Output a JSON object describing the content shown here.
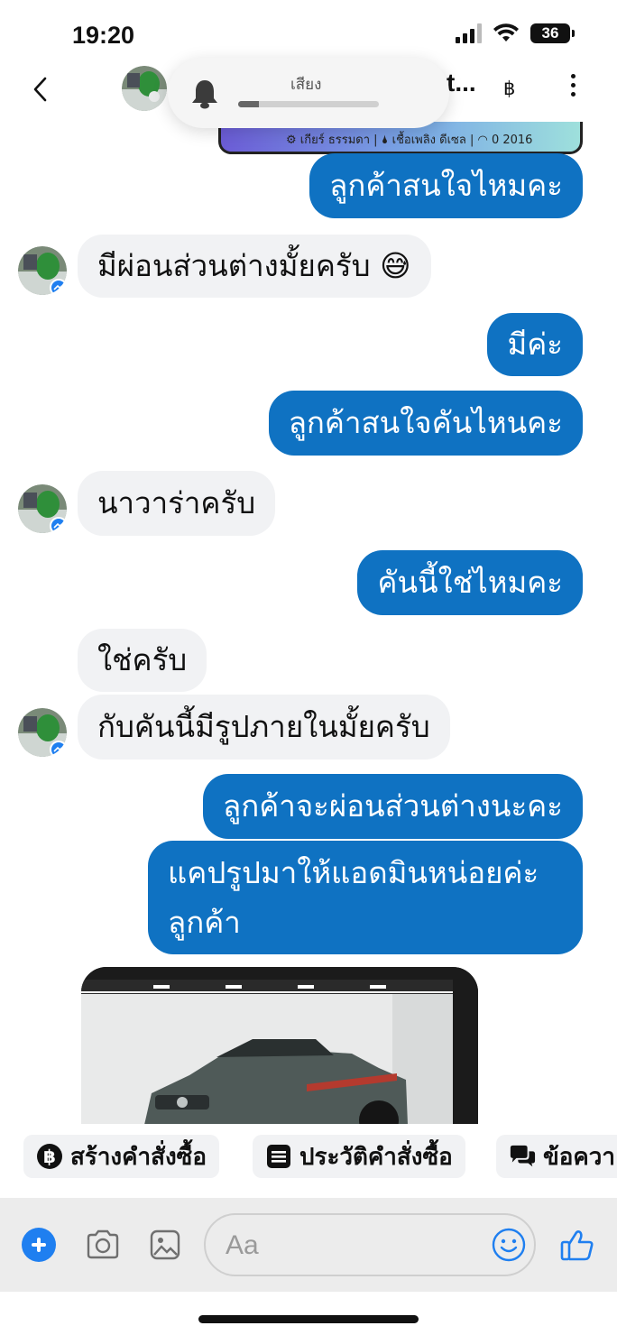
{
  "status_bar": {
    "time": "19:20",
    "battery": "36"
  },
  "header": {
    "title": "t...",
    "baht_symbol": "฿"
  },
  "volume_hud": {
    "label": "เสียง",
    "level_fraction": 0.15
  },
  "shared_card": {
    "text": "⚙ เกียร์ ธรรมดา  |  🌢 เชื้อเพลิง ดีเซล  |  ◠ 0 2016"
  },
  "messages": [
    {
      "id": "m1",
      "side": "out",
      "text": "ลูกค้าสนใจไหมคะ"
    },
    {
      "id": "m2",
      "side": "in",
      "text": "มีผ่อนส่วนต่างมั้ยครับ 😅"
    },
    {
      "id": "m3",
      "side": "out",
      "text": "มีค่ะ"
    },
    {
      "id": "m4",
      "side": "out",
      "text": "ลูกค้าสนใจคันไหนคะ"
    },
    {
      "id": "m5",
      "side": "in",
      "text": "นาวาร่าครับ"
    },
    {
      "id": "m6",
      "side": "out",
      "text": "คันนี้ใช่ไหมคะ"
    },
    {
      "id": "m7",
      "side": "in",
      "text": "ใช่ครับ"
    },
    {
      "id": "m8",
      "side": "in",
      "text": "กับคันนี้มีรูปภายในมั้ยครับ"
    },
    {
      "id": "m9",
      "side": "out",
      "text": "ลูกค้าจะผ่อนส่วนต่างนะคะ"
    },
    {
      "id": "m10",
      "side": "out",
      "text": "แคปรูปมาให้แอดมินหน่อยค่ะลูกค้า"
    }
  ],
  "quick_actions": [
    {
      "label": "สร้างคำสั่งซื้อ",
      "icon": "baht-circle-icon"
    },
    {
      "label": "ประวัติคำสั่งซื้อ",
      "icon": "list-icon"
    },
    {
      "label": "ข้อควา",
      "icon": "chat-bubbles-icon"
    }
  ],
  "composer": {
    "placeholder": "Aa"
  },
  "colors": {
    "outgoing_bubble": "#0f72c2",
    "incoming_bubble": "#f1f2f4",
    "accent": "#1f7ff0"
  }
}
